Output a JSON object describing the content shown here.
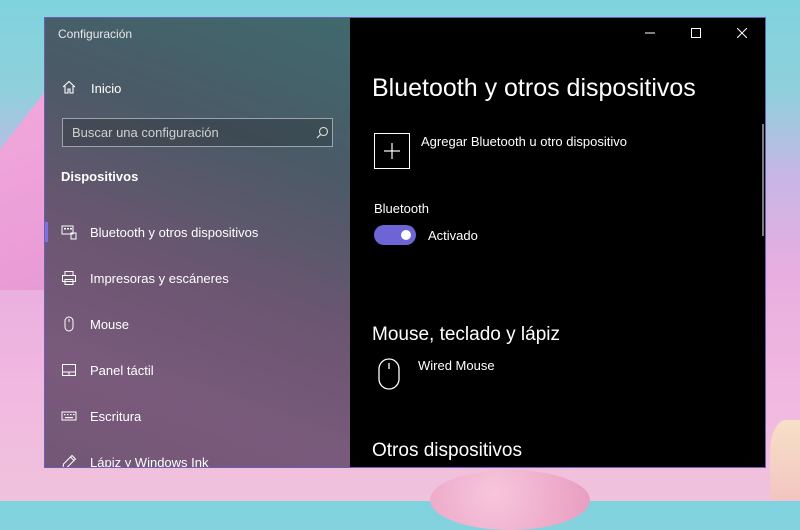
{
  "window": {
    "title": "Configuración"
  },
  "sidebar": {
    "home_label": "Inicio",
    "search_placeholder": "Buscar una configuración",
    "section_title": "Dispositivos",
    "items": [
      {
        "label": "Bluetooth y otros dispositivos",
        "icon": "bluetooth-devices-icon",
        "active": true
      },
      {
        "label": "Impresoras y escáneres",
        "icon": "printer-icon",
        "active": false
      },
      {
        "label": "Mouse",
        "icon": "mouse-icon",
        "active": false
      },
      {
        "label": "Panel táctil",
        "icon": "touchpad-icon",
        "active": false
      },
      {
        "label": "Escritura",
        "icon": "keyboard-icon",
        "active": false
      },
      {
        "label": "Lápiz y Windows Ink",
        "icon": "pen-icon",
        "active": false
      }
    ]
  },
  "content": {
    "title": "Bluetooth y otros dispositivos",
    "add_device_label": "Agregar Bluetooth u otro dispositivo",
    "bluetooth_label": "Bluetooth",
    "bluetooth_state": "Activado",
    "bluetooth_on": true,
    "section_mouse": "Mouse, teclado y lápiz",
    "devices": [
      {
        "name": "Wired Mouse",
        "icon": "mouse-icon"
      }
    ],
    "section_other": "Otros dispositivos"
  },
  "colors": {
    "accent": "#6d65d6",
    "content_bg": "#000000"
  }
}
